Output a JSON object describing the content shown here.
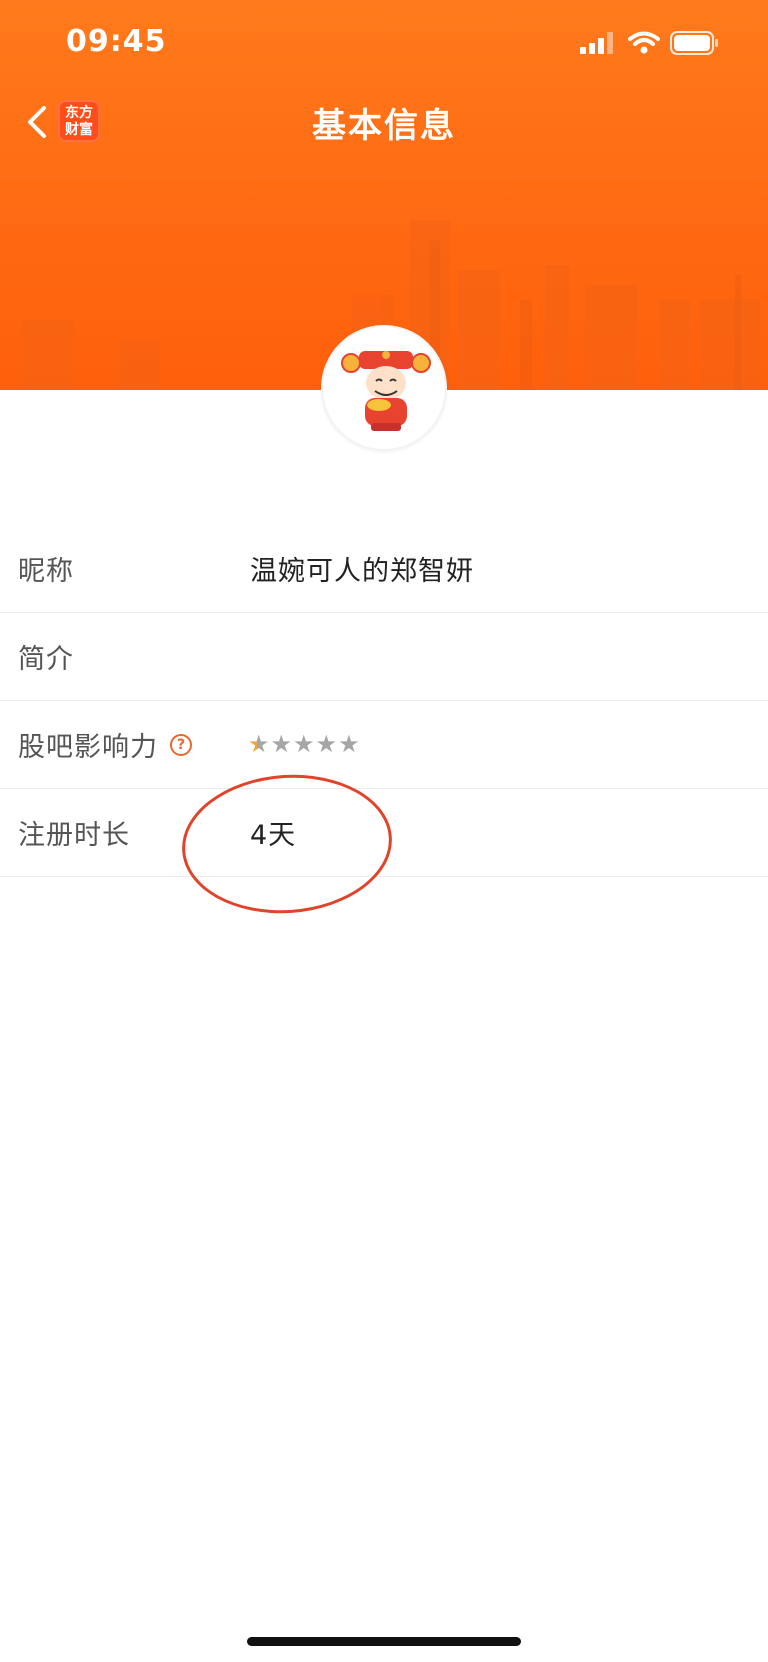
{
  "status_bar": {
    "time": "09:45"
  },
  "nav": {
    "logo_text_line1": "东方",
    "logo_text_line2": "财富",
    "title": "基本信息"
  },
  "profile": {
    "rows": [
      {
        "label": "昵称",
        "value": "温婉可人的郑智妍"
      },
      {
        "label": "简介",
        "value": ""
      },
      {
        "label": "股吧影响力",
        "help": "?",
        "rating": 0.4,
        "rating_max": 5,
        "stars": [
          "★",
          "★",
          "★",
          "★",
          "★"
        ]
      },
      {
        "label": "注册时长",
        "value": "4天"
      }
    ]
  },
  "colors": {
    "header": "#ff6a12",
    "accent": "#e8692b",
    "annotation": "#e0442a"
  },
  "icons": {
    "back": "back-chevron-icon",
    "help": "question-circle-icon",
    "star": "star-icon"
  }
}
